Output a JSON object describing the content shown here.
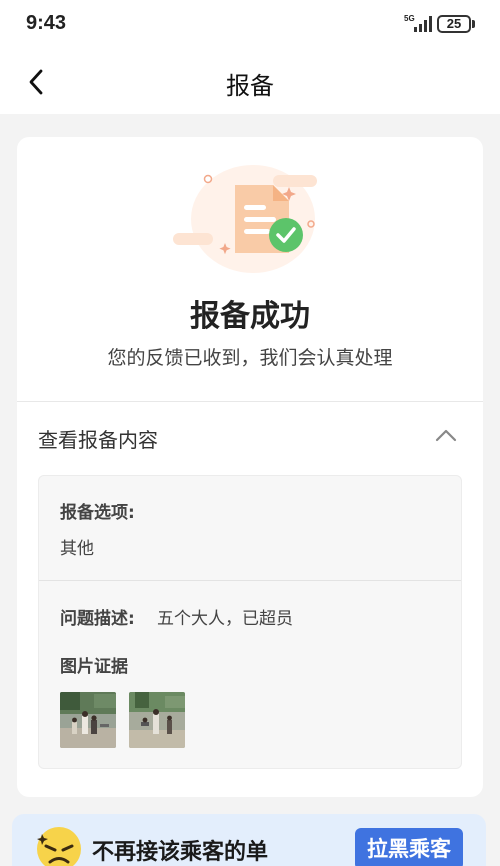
{
  "status_bar": {
    "time": "9:43",
    "network": "5G",
    "battery": "25"
  },
  "nav": {
    "title": "报备"
  },
  "result": {
    "title": "报备成功",
    "subtitle": "您的反馈已收到，我们会认真处理"
  },
  "details": {
    "section_title": "查看报备内容",
    "option_label": "报备选项:",
    "option_value": "其他",
    "desc_label": "问题描述:",
    "desc_value": "五个大人，已超员",
    "evidence_label": "图片证据",
    "evidence_count": 2
  },
  "banner": {
    "text": "不再接该乘客的单",
    "button_label": "拉黑乘客"
  },
  "colors": {
    "success_green": "#5cc46a",
    "accent_blue": "#3f73e0",
    "banner_bg": "#e3eefc",
    "illustration_orange": "#f8c9a3"
  }
}
